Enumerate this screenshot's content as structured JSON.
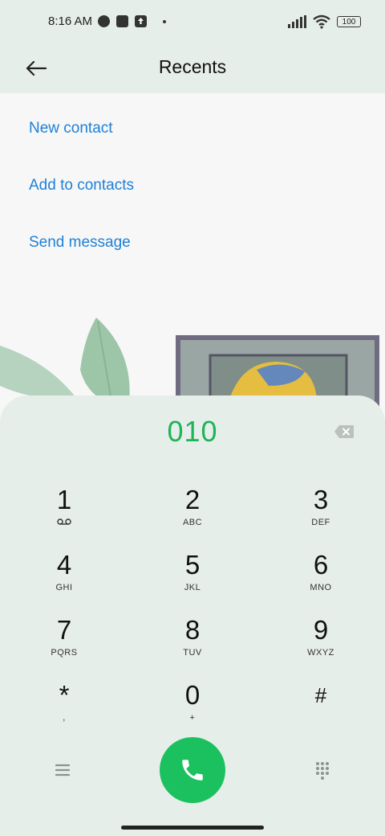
{
  "status_bar": {
    "time": "8:16 AM",
    "battery": "100",
    "icons": [
      "notification-icon",
      "square-icon",
      "upload-icon",
      "dot-icon",
      "signal-icon",
      "wifi-icon",
      "battery-icon"
    ]
  },
  "header": {
    "title": "Recents",
    "back_icon": "back-arrow-icon"
  },
  "menu": {
    "items": [
      {
        "label": "New contact"
      },
      {
        "label": "Add to contacts"
      },
      {
        "label": "Send message"
      }
    ]
  },
  "dialer": {
    "number": "010",
    "keys": [
      {
        "digit": "1",
        "letters": ""
      },
      {
        "digit": "2",
        "letters": "ABC"
      },
      {
        "digit": "3",
        "letters": "DEF"
      },
      {
        "digit": "4",
        "letters": "GHI"
      },
      {
        "digit": "5",
        "letters": "JKL"
      },
      {
        "digit": "6",
        "letters": "MNO"
      },
      {
        "digit": "7",
        "letters": "PQRS"
      },
      {
        "digit": "8",
        "letters": "TUV"
      },
      {
        "digit": "9",
        "letters": "WXYZ"
      },
      {
        "digit": "*",
        "letters": ","
      },
      {
        "digit": "0",
        "letters": "+"
      },
      {
        "digit": "#",
        "letters": ""
      }
    ]
  },
  "colors": {
    "accent_blue": "#1f80d8",
    "number_green": "#1fb35a",
    "call_green": "#1cc15f",
    "panel_bg": "#e6eee9"
  }
}
